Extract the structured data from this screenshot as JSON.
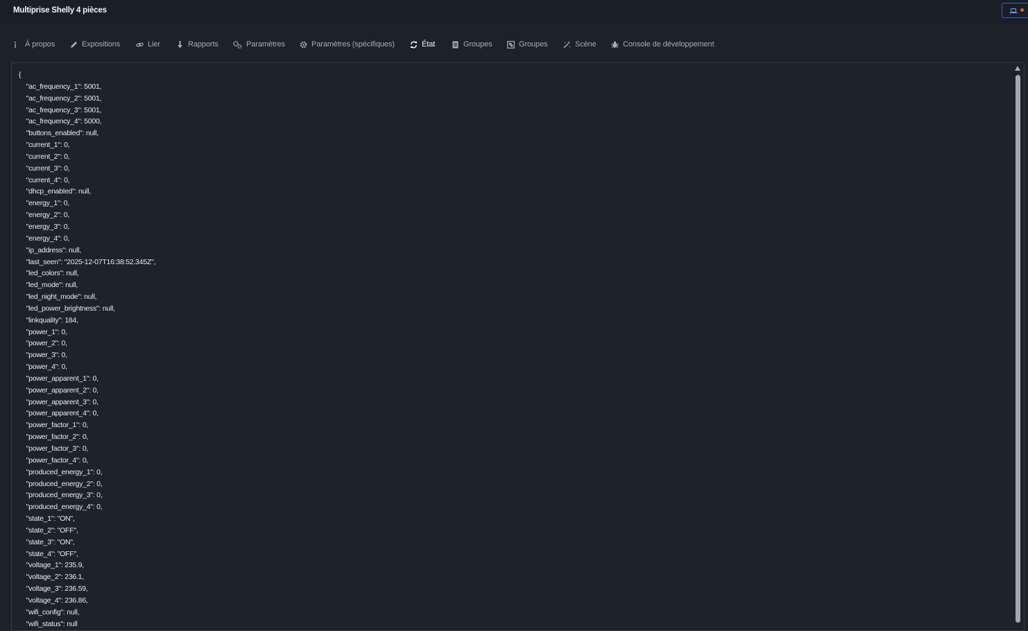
{
  "window": {
    "title": "Multiprise Shelly 4 pièces"
  },
  "colors": {
    "background": "#1d2229",
    "accent": "#3b63c9",
    "notification_dot": "#e25555"
  },
  "tabs": [
    {
      "label": "À propos",
      "icon": "info-icon",
      "active": false
    },
    {
      "label": "Expositions",
      "icon": "pencil-icon",
      "active": false
    },
    {
      "label": "Lier",
      "icon": "link-icon",
      "active": false
    },
    {
      "label": "Rapports",
      "icon": "download-arrow-icon",
      "active": false
    },
    {
      "label": "Paramètres",
      "icon": "gears-icon",
      "active": false
    },
    {
      "label": "Paramètres (spécifiques)",
      "icon": "gear-icon",
      "active": false
    },
    {
      "label": "État",
      "icon": "sync-icon",
      "active": true
    },
    {
      "label": "Groupes",
      "icon": "document-icon",
      "active": false
    },
    {
      "label": "Groupes",
      "icon": "object-group-icon",
      "active": false
    },
    {
      "label": "Scène",
      "icon": "wand-icon",
      "active": false
    },
    {
      "label": "Console de développement",
      "icon": "bug-icon",
      "active": false
    }
  ],
  "state_json": "{\n    \"ac_frequency_1\": 5001,\n    \"ac_frequency_2\": 5001,\n    \"ac_frequency_3\": 5001,\n    \"ac_frequency_4\": 5000,\n    \"buttons_enabled\": null,\n    \"current_1\": 0,\n    \"current_2\": 0,\n    \"current_3\": 0,\n    \"current_4\": 0,\n    \"dhcp_enabled\": null,\n    \"energy_1\": 0,\n    \"energy_2\": 0,\n    \"energy_3\": 0,\n    \"energy_4\": 0,\n    \"ip_address\": null,\n    \"last_seen\": \"2025-12-07T16:38:52.345Z\",\n    \"led_colors\": null,\n    \"led_mode\": null,\n    \"led_night_mode\": null,\n    \"led_power_brightness\": null,\n    \"linkquality\": 184,\n    \"power_1\": 0,\n    \"power_2\": 0,\n    \"power_3\": 0,\n    \"power_4\": 0,\n    \"power_apparent_1\": 0,\n    \"power_apparent_2\": 0,\n    \"power_apparent_3\": 0,\n    \"power_apparent_4\": 0,\n    \"power_factor_1\": 0,\n    \"power_factor_2\": 0,\n    \"power_factor_3\": 0,\n    \"power_factor_4\": 0,\n    \"produced_energy_1\": 0,\n    \"produced_energy_2\": 0,\n    \"produced_energy_3\": 0,\n    \"produced_energy_4\": 0,\n    \"state_1\": \"ON\",\n    \"state_2\": \"OFF\",\n    \"state_3\": \"ON\",\n    \"state_4\": \"OFF\",\n    \"voltage_1\": 235.9,\n    \"voltage_2\": 236.1,\n    \"voltage_3\": 236.59,\n    \"voltage_4\": 236.86,\n    \"wifi_config\": null,\n    \"wifi_status\": null"
}
